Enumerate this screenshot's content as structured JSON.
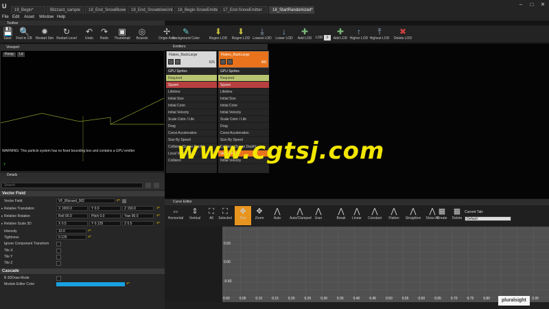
{
  "app": {
    "tabs": [
      "19_Begin*",
      "Blizzard_sample",
      "19_End_SnowBlowerL..",
      "19_End_SnowblowUnLit",
      "16_Begin-SnowEmitter",
      "17_End-SnowEmitter",
      "18_StartRandomized*"
    ]
  },
  "menu": [
    "File",
    "Edit",
    "Asset",
    "Window",
    "Help"
  ],
  "toolbar": {
    "tab": "Toolbar",
    "buttons": [
      {
        "label": "Save",
        "icon": "save-icon"
      },
      {
        "label": "Find in CB",
        "icon": "find-icon"
      },
      {
        "label": "Restart Sim",
        "icon": "restart-sim-icon"
      },
      {
        "label": "Restart Level",
        "icon": "restart-level-icon"
      },
      {
        "label": "Undo",
        "icon": "undo-icon"
      },
      {
        "label": "Redo",
        "icon": "redo-icon"
      },
      {
        "label": "Thumbnail",
        "icon": "thumbnail-icon"
      },
      {
        "label": "Bounds",
        "icon": "bounds-icon"
      },
      {
        "label": "Origin Axis",
        "icon": "origin-axis-icon"
      },
      {
        "label": "Background Color",
        "icon": "background-color-icon"
      },
      {
        "label": "Regen LOD",
        "icon": "regen-lod-icon"
      },
      {
        "label": "Regen LOD",
        "icon": "regen-lod-icon"
      },
      {
        "label": "Lowest LOD",
        "icon": "lowest-lod-icon"
      },
      {
        "label": "Lower LOD",
        "icon": "lower-lod-icon"
      },
      {
        "label": "Add LOD",
        "icon": "add-lod-icon"
      },
      {
        "label": "LOD",
        "icon": "lod-icon"
      },
      {
        "label": "Add LOD",
        "icon": "add-lod-icon"
      },
      {
        "label": "Higher LOD",
        "icon": "higher-lod-icon"
      },
      {
        "label": "Highest LOD",
        "icon": "highest-lod-icon"
      },
      {
        "label": "Delete LOD",
        "icon": "delete-lod-icon"
      }
    ],
    "lod_value": "0"
  },
  "viewport": {
    "tab": "Viewport",
    "buttons": [
      "Persp",
      "Lit"
    ],
    "warning": "WARNING: This particle system has no fixed bounding box and contains a GPU emitter"
  },
  "details": {
    "tab": "Details",
    "search_placeholder": "Search",
    "vector_section": "Vector Field",
    "vector_field_label": "Vector Field",
    "vector_field_value": "VF_Blizzard_002",
    "rows": [
      {
        "label": "Relative Translation",
        "x": "X 1000.0",
        "y": "Y 0.0",
        "z": "Z 150.0"
      },
      {
        "label": "Relative Rotation",
        "x": "Roll 90.0",
        "y": "Pitch 0.0",
        "z": "Yaw 90.0"
      },
      {
        "label": "Relative Scale 3D",
        "x": "X 0.5",
        "y": "Y 0.125",
        "z": "Z 0.5"
      }
    ],
    "intensity_label": "Intensity",
    "intensity": "10.0",
    "tightness_label": "Tightness",
    "tightness": "0.125",
    "ignore_label": "Ignore Component Transform",
    "tilex": "Tile X",
    "tiley": "Tile Y",
    "tilez": "Tile Z",
    "cascade_section": "Cascade",
    "draw_mode": "B 3DDraw Mode",
    "module_color": "Module Editor Color"
  },
  "emitters": {
    "tab": "Emitters",
    "columns": [
      {
        "title": "Flakes_BackLarge",
        "count": "625",
        "header_color": "#d8d8d8",
        "type": "GPU Sprites",
        "modules": [
          "Required",
          "Spawn",
          "Lifetime",
          "Initial Size",
          "Initial Color",
          "Initial Velocity",
          "Scale Color / Life",
          "Drag",
          "Const Acceleration",
          "Size By Speed",
          "Collision (Scene Depth)",
          "Local Vector Field",
          "Collision"
        ]
      },
      {
        "title": "Flakes_BackLarge",
        "count": "481",
        "header_color": "#e8731c",
        "type": "GPU Sprites",
        "modules": [
          "Required",
          "Spawn",
          "Lifetime",
          "Initial Size",
          "Initial Color",
          "Initial Velocity",
          "Scale Color / Life",
          "Drag",
          "Const Acceleration",
          "Size By Speed",
          "Collision (Scene Depth)",
          "Vector Field",
          "Initial Velocity"
        ]
      }
    ]
  },
  "curve": {
    "tab": "Curve Editor",
    "buttons": [
      "Horizontal",
      "Vertical",
      "All",
      "Selected",
      "Pan",
      "Zoom",
      "Auto",
      "Auto/Clamped",
      "User",
      "Break",
      "Linear",
      "Constant",
      "Flatten",
      "Straighten",
      "Show All",
      "Create",
      "Delete"
    ],
    "current_tab_label": "Current Tab:",
    "current_tab_value": "Default",
    "y_ticks": [
      "0.50",
      "0.00",
      "-0.50"
    ],
    "x_ticks": [
      "0.00",
      "0.05",
      "0.10",
      "0.15",
      "0.20",
      "0.25",
      "0.30",
      "0.35",
      "0.40",
      "0.45",
      "0.50",
      "0.55",
      "0.60",
      "0.65",
      "0.70",
      "0.75",
      "0.80",
      "0.85",
      "0.90",
      "0.95"
    ]
  },
  "watermark": "www.cgtsj.com",
  "brand": "pluralsight"
}
